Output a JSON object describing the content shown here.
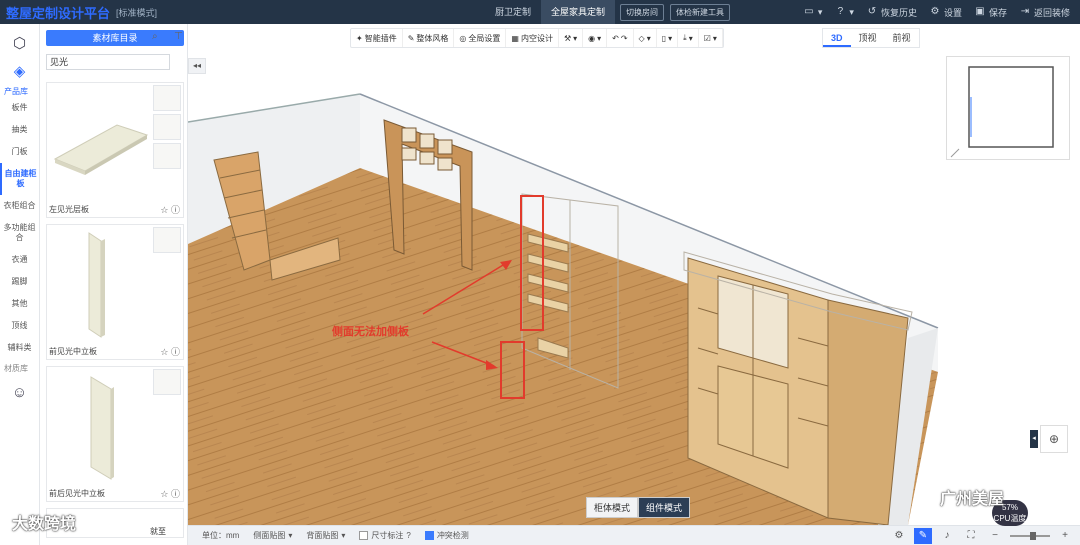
{
  "app": {
    "title": "整屋定制设计平台",
    "mode": "[标准模式]"
  },
  "top_tabs": [
    {
      "label": "厨卫定制",
      "active": false
    },
    {
      "label": "全屋家具定制",
      "active": true
    }
  ],
  "top_buttons": [
    "切换房间",
    "体检新建工具"
  ],
  "top_actions": [
    {
      "icon": "file-icon",
      "label": ""
    },
    {
      "icon": "help-icon",
      "label": ""
    },
    {
      "icon": "history-icon",
      "label": "恢复历史"
    },
    {
      "icon": "gear-icon",
      "label": "设置"
    },
    {
      "icon": "save-icon",
      "label": "保存"
    },
    {
      "icon": "exit-icon",
      "label": "返回装修"
    }
  ],
  "rail": {
    "head": "产品库",
    "items": [
      {
        "label": "板件",
        "active": false
      },
      {
        "label": "抽类",
        "active": false
      },
      {
        "label": "门板",
        "active": false
      },
      {
        "label": "自由建柜板",
        "active": true
      },
      {
        "label": "衣柜组合",
        "active": false
      },
      {
        "label": "多功能组合",
        "active": false
      },
      {
        "label": "衣通",
        "active": false
      },
      {
        "label": "踢脚",
        "active": false
      },
      {
        "label": "其他",
        "active": false
      },
      {
        "label": "顶线",
        "active": false
      },
      {
        "label": "辅料类",
        "active": false
      }
    ],
    "head2": "材质库"
  },
  "panel": {
    "catalog_button": "素材库目录",
    "search_value": "见光",
    "cards": [
      {
        "name": "左见光层板"
      },
      {
        "name": "前见光中立板"
      },
      {
        "name": "前后见光中立板"
      }
    ],
    "footer": "就至"
  },
  "toolbar": {
    "items": [
      "智能插件",
      "整体风格",
      "全局设置",
      "内空设计",
      "",
      "",
      "",
      "",
      "",
      "",
      ""
    ]
  },
  "view_tabs": [
    {
      "label": "3D",
      "active": true
    },
    {
      "label": "顶视",
      "active": false
    },
    {
      "label": "前视",
      "active": false
    }
  ],
  "canvas": {
    "annotation": "侧面无法加侧板",
    "colors": {
      "annotation": "#e23b2c",
      "wood": "#c8955a",
      "cabinet": "#e8d3a8"
    }
  },
  "mode_switch": [
    {
      "label": "柜体模式",
      "active": false
    },
    {
      "label": "组件模式",
      "active": true
    }
  ],
  "status": {
    "unit": "单位：mm",
    "items": [
      "侧面贴图",
      "背面贴图",
      "尺寸标注",
      "冲突检测"
    ],
    "checks": {
      "尺寸标注": false,
      "冲突检测": true
    },
    "cpu_percent": "57%",
    "cpu_label": "CPU温度"
  },
  "watermarks": [
    "大数跨境",
    "广州美屋"
  ]
}
